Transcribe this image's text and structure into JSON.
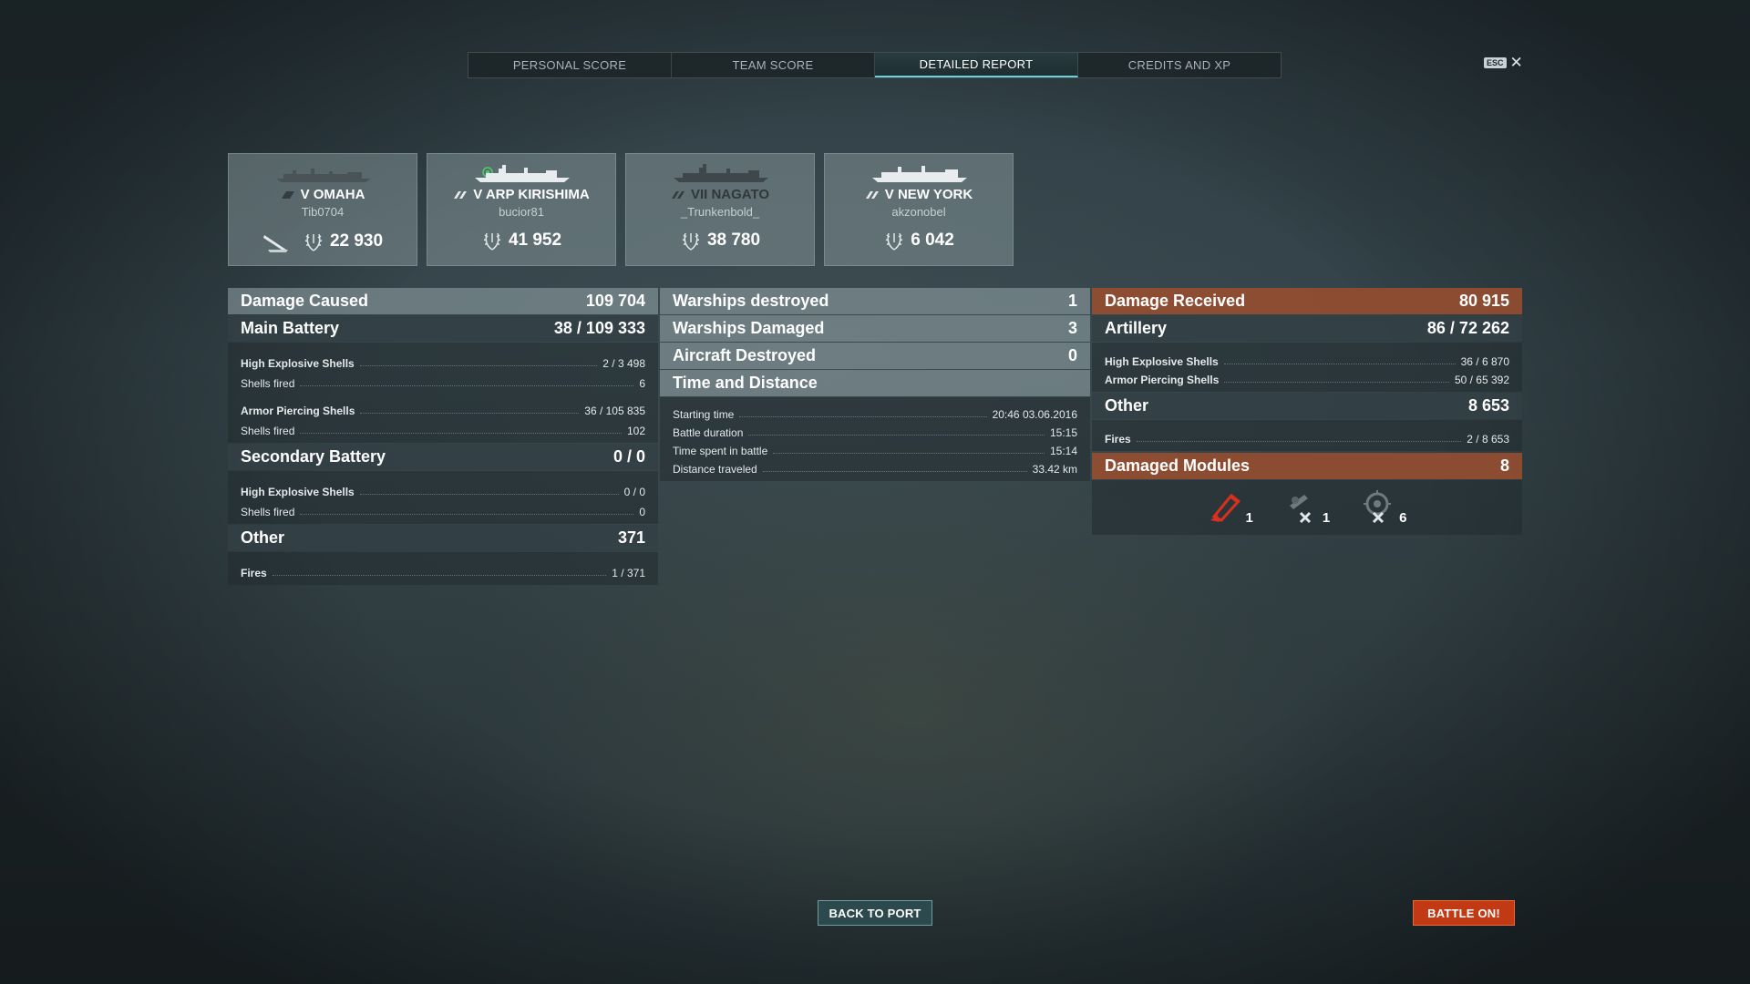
{
  "tabs": [
    {
      "label": "PERSONAL SCORE",
      "active": false
    },
    {
      "label": "TEAM SCORE",
      "active": false
    },
    {
      "label": "DETAILED REPORT",
      "active": true
    },
    {
      "label": "CREDITS AND XP",
      "active": false
    }
  ],
  "esc": {
    "key": "ESC",
    "close": "✕"
  },
  "cards": [
    {
      "ship": "V OMAHA",
      "player": "Tib0704",
      "score": "22 930",
      "icons": [
        "cruiser-icon",
        "laurel-icon",
        "torpedo-icon"
      ]
    },
    {
      "ship": "V ARP KIRISHIMA",
      "player": "bucior81",
      "score": "41 952",
      "icons": [
        "battleship-icon",
        "laurel-icon",
        "flag-icon"
      ]
    },
    {
      "ship": "VII NAGATO",
      "player": "_Trunkenbold_",
      "score": "38 780",
      "icons": [
        "battleship-icon",
        "laurel-icon"
      ]
    },
    {
      "ship": "V NEW YORK",
      "player": "akzonobel",
      "score": "6 042",
      "icons": [
        "battleship-icon",
        "laurel-icon"
      ]
    }
  ],
  "damage_caused": {
    "title": "Damage Caused",
    "value": "109 704",
    "main_battery": {
      "title": "Main Battery",
      "value": "38 / 109 333",
      "he_label": "High Explosive Shells",
      "he_value": "2 / 3 498",
      "he_fired_label": "Shells fired",
      "he_fired": "6",
      "ap_label": "Armor Piercing Shells",
      "ap_value": "36 / 105 835",
      "ap_fired_label": "Shells fired",
      "ap_fired": "102"
    },
    "secondary": {
      "title": "Secondary Battery",
      "value": "0 / 0",
      "he_label": "High Explosive Shells",
      "he_value": "0 / 0",
      "fired_label": "Shells fired",
      "fired": "0"
    },
    "other": {
      "title": "Other",
      "value": "371",
      "fires_label": "Fires",
      "fires_value": "1 / 371"
    }
  },
  "middle": {
    "warships_destroyed": {
      "label": "Warships destroyed",
      "value": "1"
    },
    "warships_damaged": {
      "label": "Warships Damaged",
      "value": "3"
    },
    "aircraft_destroyed": {
      "label": "Aircraft Destroyed",
      "value": "0"
    },
    "time_distance": {
      "title": "Time and Distance",
      "starting_label": "Starting time",
      "starting_value": "20:46  03.06.2016",
      "duration_label": "Battle duration",
      "duration_value": "15:15",
      "spent_label": "Time spent in battle",
      "spent_value": "15:14",
      "distance_label": "Distance traveled",
      "distance_value": "33.42 km"
    }
  },
  "damage_received": {
    "title": "Damage Received",
    "value": "80 915",
    "artillery": {
      "title": "Artillery",
      "value": "86 / 72 262",
      "he_label": "High Explosive Shells",
      "he_value": "36 / 6 870",
      "ap_label": "Armor Piercing Shells",
      "ap_value": "50 / 65 392"
    },
    "other": {
      "title": "Other",
      "value": "8 653",
      "fires_label": "Fires",
      "fires_value": "2 / 8 653"
    },
    "modules": {
      "title": "Damaged Modules",
      "value": "8",
      "items": [
        {
          "icon": "fire-module-icon",
          "count": "1",
          "color": "#d8301c"
        },
        {
          "icon": "torpedo-tube-destroyed-icon",
          "count": "1",
          "color": "#8c979b"
        },
        {
          "icon": "secondary-gun-destroyed-icon",
          "count": "6",
          "color": "#8c979b"
        }
      ]
    }
  },
  "buttons": {
    "back": "BACK TO PORT",
    "battle": "BATTLE ON!"
  },
  "colors": {
    "accent": "#6fd0d6",
    "received_header": "#964e30",
    "battle_button": "#c23a14"
  }
}
